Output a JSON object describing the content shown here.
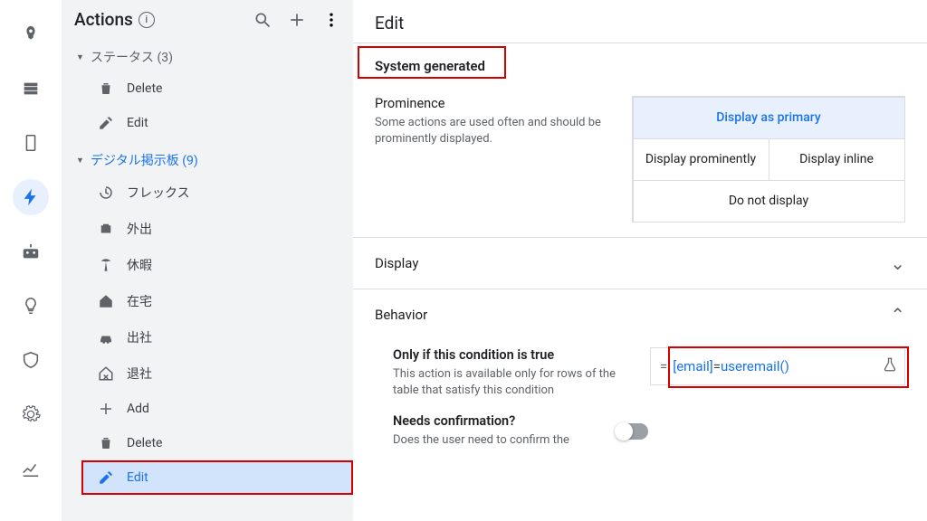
{
  "rail": {
    "items": [
      "launch",
      "database",
      "device",
      "bolt",
      "robot",
      "bulb",
      "shield",
      "gear",
      "chart"
    ],
    "active_index": 3
  },
  "sidebar": {
    "title": "Actions",
    "groups": [
      {
        "label": "ステータス (3)",
        "expanded": false,
        "items": [
          {
            "icon": "trash",
            "label": "Delete"
          },
          {
            "icon": "edit",
            "label": "Edit"
          }
        ]
      },
      {
        "label": "デジタル掲示板 (9)",
        "expanded": true,
        "items": [
          {
            "icon": "history",
            "label": "フレックス"
          },
          {
            "icon": "briefcase",
            "label": "外出"
          },
          {
            "icon": "island",
            "label": "休暇"
          },
          {
            "icon": "house",
            "label": "在宅"
          },
          {
            "icon": "car",
            "label": "出社"
          },
          {
            "icon": "housex",
            "label": "退社"
          },
          {
            "icon": "plus",
            "label": "Add"
          },
          {
            "icon": "trash",
            "label": "Delete"
          },
          {
            "icon": "edit",
            "label": "Edit",
            "selected": true,
            "boxed": true
          }
        ]
      }
    ]
  },
  "main": {
    "title": "Edit",
    "system_section": "System generated",
    "prominence": {
      "title": "Prominence",
      "sub": "Some actions are used often and should be prominently displayed.",
      "options": [
        "Display as primary",
        "Display prominently",
        "Display inline",
        "Do not display"
      ],
      "selected_index": 0
    },
    "display_section": "Display",
    "behavior_section": "Behavior",
    "condition": {
      "title": "Only if this condition is true",
      "sub": "This action is available only for rows of the table that satisfy this condition",
      "expr_field": "[email]",
      "expr_op": "=",
      "expr_fn": "useremail()"
    },
    "confirm": {
      "title": "Needs confirmation?",
      "sub": "Does the user need to confirm the"
    }
  }
}
